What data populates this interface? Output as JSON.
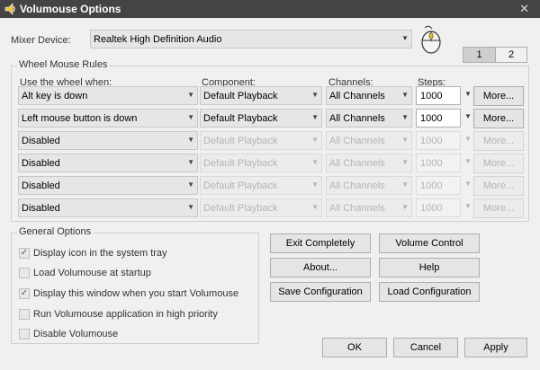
{
  "window": {
    "title": "Volumouse Options",
    "close_glyph": "✕"
  },
  "mixer": {
    "label": "Mixer Device:",
    "value": "Realtek High Definition Audio"
  },
  "tabs": [
    "1",
    "2"
  ],
  "rules": {
    "legend": "Wheel Mouse Rules",
    "headers": {
      "use": "Use the wheel when:",
      "component": "Component:",
      "channels": "Channels:",
      "steps": "Steps:"
    },
    "rows": [
      {
        "use": "Alt key is down",
        "component": "Default Playback",
        "channels": "All Channels",
        "steps": "1000",
        "more": "More...",
        "enabled": true
      },
      {
        "use": "Left mouse button is down",
        "component": "Default Playback",
        "channels": "All Channels",
        "steps": "1000",
        "more": "More...",
        "enabled": true
      },
      {
        "use": "Disabled",
        "component": "Default Playback",
        "channels": "All Channels",
        "steps": "1000",
        "more": "More...",
        "enabled": false
      },
      {
        "use": "Disabled",
        "component": "Default Playback",
        "channels": "All Channels",
        "steps": "1000",
        "more": "More...",
        "enabled": false
      },
      {
        "use": "Disabled",
        "component": "Default Playback",
        "channels": "All Channels",
        "steps": "1000",
        "more": "More...",
        "enabled": false
      },
      {
        "use": "Disabled",
        "component": "Default Playback",
        "channels": "All Channels",
        "steps": "1000",
        "more": "More...",
        "enabled": false
      }
    ]
  },
  "general": {
    "legend": "General Options",
    "options": [
      {
        "label": "Display icon in the system tray",
        "checked": true
      },
      {
        "label": "Load Volumouse at startup",
        "checked": false
      },
      {
        "label": "Display this window when you start Volumouse",
        "checked": true
      },
      {
        "label": "Run Volumouse application in high priority",
        "checked": false
      },
      {
        "label": "Disable Volumouse",
        "checked": false
      }
    ]
  },
  "buttons": {
    "exit": "Exit Completely",
    "volume_control": "Volume Control",
    "about": "About...",
    "help": "Help",
    "save": "Save Configuration",
    "load": "Load Configuration",
    "ok": "OK",
    "cancel": "Cancel",
    "apply": "Apply"
  },
  "icons": {
    "app": "mouse-speaker-icon",
    "close": "close-icon",
    "mouse": "mouse-icon",
    "dropdown": "chevron-down-icon"
  }
}
